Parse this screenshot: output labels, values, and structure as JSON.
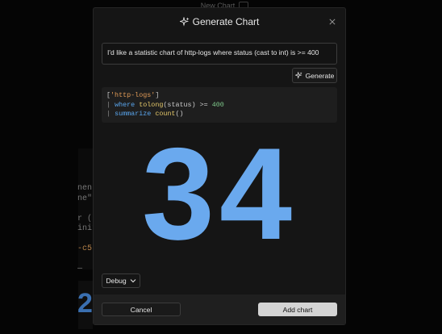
{
  "background": {
    "header_title": "New Chart",
    "code_fragments": [
      "nen\"",
      "ne\"t",
      "",
      "r (",
      "init",
      "",
      "-c5-",
      "",
      "—"
    ],
    "big_glyph": "2"
  },
  "dialog": {
    "title": "Generate Chart",
    "title_icon": "sparkle-icon",
    "close_icon": "close-icon",
    "prompt_value": "I'd like a statistic chart of http-logs where status (cast to int) is >= 400",
    "generate_label": "Generate",
    "query": {
      "line1": {
        "open": "[",
        "table": "'http-logs'",
        "close": "]"
      },
      "line2": {
        "pipe": "|",
        "kw": "where",
        "fn": "tolong",
        "arg": "(status)",
        "op": ">=",
        "num": "400"
      },
      "line3": {
        "pipe": "|",
        "kw": "summarize",
        "fn": "count",
        "arg": "()"
      }
    },
    "result_value": "34",
    "debug_label": "Debug",
    "cancel_label": "Cancel",
    "add_label": "Add chart"
  },
  "colors": {
    "accent_number": "#6aa9ee",
    "primary_button": "#d4d4d4",
    "dialog_bg": "#151515"
  }
}
